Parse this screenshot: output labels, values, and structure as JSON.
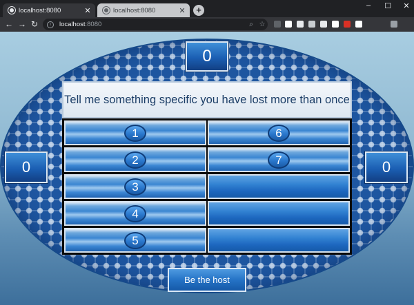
{
  "browser": {
    "tabs": [
      {
        "title": "localhost:8080",
        "close": "✕"
      },
      {
        "title": "localhost:8080",
        "close": "✕"
      }
    ],
    "new_tab_glyph": "+",
    "window_controls": {
      "minimize": "–",
      "maximize": "☐",
      "close": "✕"
    },
    "nav": {
      "back": "←",
      "forward": "→",
      "reload": "↻"
    },
    "url_host": "localhost",
    "url_port": ":8080",
    "omnibox_icons": {
      "zoom": "⌕",
      "bookmark": "☆"
    },
    "extension_colors": [
      "#5f6368",
      "#ffffff",
      "#e8eaed",
      "#c9cdd1",
      "#e8eaed",
      "#ffffff",
      "#d93025",
      "#ffffff",
      "#9aa0a6"
    ]
  },
  "game": {
    "team_score_top": "0",
    "team_score_left": "0",
    "team_score_right": "0",
    "question": "Tell me something specific you have lost more than once",
    "answers": [
      {
        "number": "1",
        "state": "hidden"
      },
      {
        "number": "2",
        "state": "hidden"
      },
      {
        "number": "3",
        "state": "hidden"
      },
      {
        "number": "4",
        "state": "hidden"
      },
      {
        "number": "5",
        "state": "hidden"
      },
      {
        "number": "6",
        "state": "hidden"
      },
      {
        "number": "7",
        "state": "hidden"
      },
      {
        "number": "",
        "state": "empty"
      },
      {
        "number": "",
        "state": "empty"
      },
      {
        "number": "",
        "state": "empty"
      }
    ],
    "host_button_label": "Be the host"
  }
}
